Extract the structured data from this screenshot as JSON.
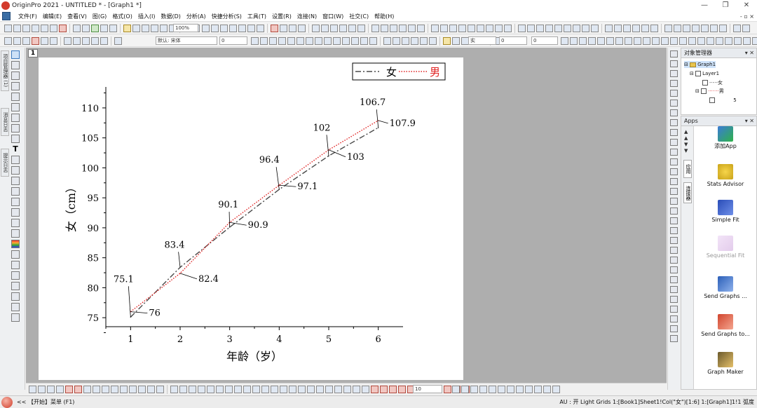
{
  "window": {
    "title": "OriginPro 2021 - UNTITLED * - [Graph1 *]",
    "buttons": {
      "minimize": "—",
      "restore": "❐",
      "close": "✕"
    }
  },
  "menu": {
    "items": [
      "文件(F)",
      "编辑(E)",
      "查看(V)",
      "图(G)",
      "格式(O)",
      "插入(I)",
      "数据(D)",
      "分析(A)",
      "快捷分析(S)",
      "工具(T)",
      "设置(R)",
      "连接(N)",
      "窗口(W)",
      "社交(C)",
      "帮助(H)"
    ],
    "right_controls": "- ▫ ×"
  },
  "toolbar": {
    "zoom_value": "100%",
    "font_name": "默认: 宋体",
    "font_size": "0",
    "line_style": "实",
    "line_width": "0",
    "pattern_value": "0",
    "symbol_size": "10"
  },
  "left_tabs": [
    "项目管理器 (1)",
    "消息日志",
    "提示日志"
  ],
  "graph": {
    "layer_tab": "1"
  },
  "object_manager": {
    "title": "对象管理器",
    "graph_name": "Graph1",
    "layer_name": "Layer1",
    "plot_female": "女",
    "plot_male": "男",
    "count": "5"
  },
  "apps_panel": {
    "title": "Apps",
    "side_tabs": [
      "应用",
      "连接器"
    ],
    "items": [
      {
        "label": "添加App",
        "icon": "add-app-icon",
        "dim": false
      },
      {
        "label": "Stats Advisor",
        "icon": "stats-advisor-icon",
        "dim": false
      },
      {
        "label": "Simple Fit",
        "icon": "simple-fit-icon",
        "dim": false
      },
      {
        "label": "Sequential Fit",
        "icon": "sequential-fit-icon",
        "dim": true
      },
      {
        "label": "Send Graphs ...",
        "icon": "send-graphs-word-icon",
        "dim": false
      },
      {
        "label": "Send Graphs to...",
        "icon": "send-graphs-ppt-icon",
        "dim": false
      },
      {
        "label": "Graph Maker",
        "icon": "graph-maker-icon",
        "dim": false
      }
    ]
  },
  "status": {
    "left": "<<  【开始】菜单 (F1)",
    "right": "AU : 开  Light Grids  1:[Book1]Sheet1!Col(\"女\")[1:6]  1:[Graph1]1!1  弧度"
  },
  "chart_data": {
    "type": "line",
    "xlabel": "年龄（岁）",
    "ylabel": "女（cm）",
    "x": [
      1,
      2,
      3,
      4,
      5,
      6
    ],
    "xlim": [
      0.5,
      6.5
    ],
    "ylim": [
      73.5,
      113.5
    ],
    "xticks": [
      1,
      2,
      3,
      4,
      5,
      6
    ],
    "yticks": [
      75,
      80,
      85,
      90,
      95,
      100,
      105,
      110
    ],
    "grid": false,
    "legend_position": "top-right",
    "series": [
      {
        "name": "女",
        "values": [
          75.1,
          83.4,
          90.1,
          96.4,
          102,
          106.7
        ],
        "color": "#4a4a4a",
        "style": "dash-dot",
        "label_text": [
          "75.1",
          "83.4",
          "90.1",
          "96.4",
          "102",
          "106.7"
        ]
      },
      {
        "name": "男",
        "values": [
          76,
          82.4,
          90.9,
          97.1,
          103,
          107.9
        ],
        "color": "#e02020",
        "style": "dotted",
        "label_text": [
          "76",
          "82.4",
          "90.9",
          "97.1",
          "103",
          "107.9"
        ]
      }
    ]
  }
}
